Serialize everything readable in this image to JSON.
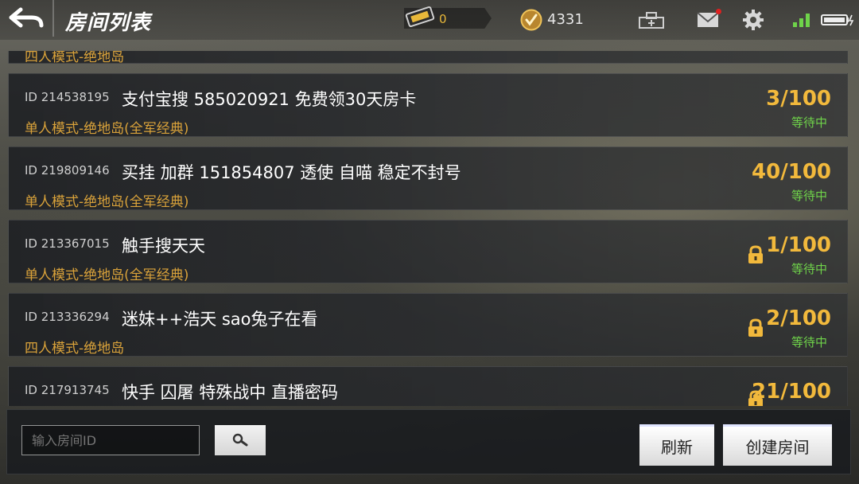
{
  "header": {
    "title": "房间列表",
    "ticket_count": "0",
    "coin_count": "4331"
  },
  "icons": {
    "back": "back-arrow-icon",
    "ticket": "ticket-icon",
    "coin": "coin-icon",
    "shop": "shop-icon",
    "mail": "mail-icon",
    "settings": "gear-icon",
    "signal": "signal-icon",
    "battery": "battery-icon",
    "lock": "lock-icon",
    "search": "search-icon"
  },
  "colors": {
    "accent_gold": "#f2b93c",
    "mode_orange": "#d9a23a",
    "status_green": "#6fd34a"
  },
  "rooms": [
    {
      "id": "",
      "name": "",
      "mode": "四人模式-绝地岛",
      "count": "",
      "status": "",
      "locked": false
    },
    {
      "id": "ID 214538195",
      "name": "支付宝搜 585020921 免费领30天房卡",
      "mode": "单人模式-绝地岛(全军经典)",
      "count": "3/100",
      "status": "等待中",
      "locked": false
    },
    {
      "id": "ID 219809146",
      "name": "买挂 加群 151854807 透使 自喵 稳定不封号",
      "mode": "单人模式-绝地岛(全军经典)",
      "count": "40/100",
      "status": "等待中",
      "locked": false
    },
    {
      "id": "ID 213367015",
      "name": "触手搜天天",
      "mode": "单人模式-绝地岛(全军经典)",
      "count": "1/100",
      "status": "等待中",
      "locked": true
    },
    {
      "id": "ID 213336294",
      "name": "迷妹++浩天  sao兔子在看",
      "mode": "四人模式-绝地岛",
      "count": "2/100",
      "status": "等待中",
      "locked": true
    },
    {
      "id": "ID 217913745",
      "name": "快手 囚屠 特殊战中 直播密码",
      "mode": "",
      "count": "21/100",
      "status": "",
      "locked": true
    }
  ],
  "footer": {
    "search_placeholder": "输入房间ID",
    "refresh_label": "刷新",
    "create_label": "创建房间"
  }
}
